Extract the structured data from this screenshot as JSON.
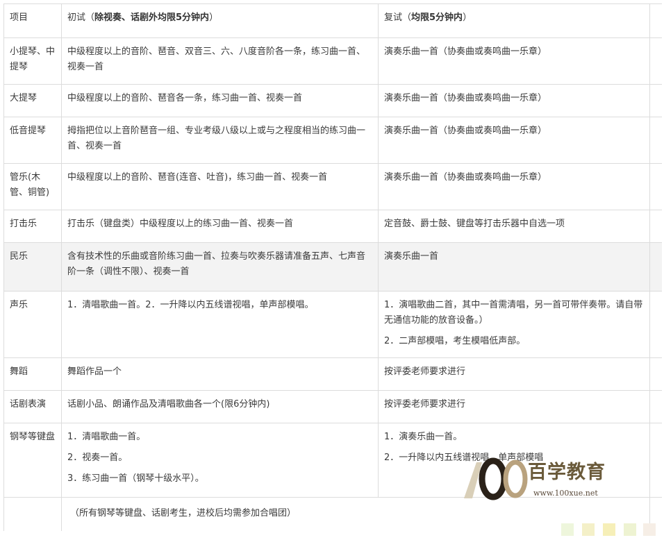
{
  "header": {
    "col0": "项目",
    "col1_prefix": "初试（",
    "col1_bold": "除视奏、话剧外均限5分钟内",
    "col1_suffix": "）",
    "col2_prefix": "复试（",
    "col2_bold": "均限5分钟内",
    "col2_suffix": "）"
  },
  "rows": [
    {
      "name": "小提琴、中提琴",
      "initial": [
        "中级程度以上的音阶、琶音、双音三、六、八度音阶各一条，练习曲一首、视奏一首"
      ],
      "final": [
        "演奏乐曲一首（协奏曲或奏鸣曲一乐章）"
      ]
    },
    {
      "name": "大提琴",
      "initial": [
        "中级程度以上的音阶、琶音各一条，练习曲一首、视奏一首"
      ],
      "final": [
        "演奏乐曲一首（协奏曲或奏鸣曲一乐章）"
      ]
    },
    {
      "name": "低音提琴",
      "initial": [
        "拇指把位以上音阶琶音一组、专业考级八级以上或与之程度相当的练习曲一首、视奏一首"
      ],
      "final": [
        "演奏乐曲一首（协奏曲或奏鸣曲一乐章）"
      ]
    },
    {
      "name": "管乐(木管、铜管)",
      "initial": [
        "中级程度以上的音阶、琶音(连音、吐音)，练习曲一首、视奏一首"
      ],
      "final": [
        "演奏乐曲一首（协奏曲或奏鸣曲一乐章）"
      ]
    },
    {
      "name": "打击乐",
      "initial": [
        "打击乐（键盘类）中级程度以上的练习曲一首、视奏一首"
      ],
      "final": [
        "定音鼓、爵士鼓、键盘等打击乐器中自选一项"
      ]
    },
    {
      "name": "民乐",
      "initial": [
        "含有技术性的乐曲或音阶练习曲一首、拉奏与吹奏乐器请准备五声、七声音阶一条（调性不限）、视奏一首"
      ],
      "final": [
        "演奏乐曲一首"
      ]
    },
    {
      "name": "声乐",
      "initial": [
        "1．清唱歌曲一首。2．一升降以内五线谱视唱，单声部模唱。"
      ],
      "final": [
        "1．演唱歌曲二首，其中一首需清唱，另一首可带伴奏带。请自带无通信功能的放音设备。）",
        "2．二声部模唱，考生模唱低声部。"
      ]
    },
    {
      "name": "舞蹈",
      "initial": [
        "舞蹈作品一个"
      ],
      "final": [
        "按评委老师要求进行"
      ]
    },
    {
      "name": "话剧表演",
      "initial": [
        "话剧小品、朗诵作品及清唱歌曲各一个(限6分钟内)"
      ],
      "final": [
        "按评委老师要求进行"
      ]
    },
    {
      "name": "钢琴等键盘",
      "initial": [
        "1．清唱歌曲一首。",
        "2．视奏一首。",
        "3．练习曲一首（钢琴十级水平）。"
      ],
      "final": [
        "1．演奏乐曲一首。",
        "2．一升降以内五线谱视唱，单声部模唱"
      ]
    }
  ],
  "footnote": "（所有钢琴等键盘、话剧考生，进校后均需参加合唱团）",
  "watermark": {
    "logo_text": "100",
    "brand": "百学教育",
    "url": "www.100xue.net"
  },
  "colors": {
    "border": "#dcdcdc",
    "shaded": "#f3f3f3",
    "text": "#3a3a3a",
    "watermark": "#6a5a3a"
  }
}
